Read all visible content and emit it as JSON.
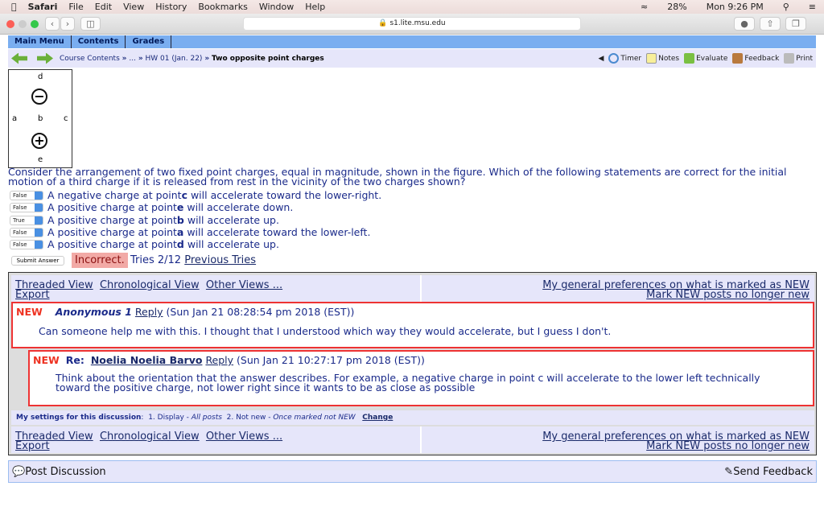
{
  "menubar": {
    "app": "Safari",
    "items": [
      "File",
      "Edit",
      "View",
      "History",
      "Bookmarks",
      "Window",
      "Help"
    ],
    "battery": "28%",
    "clock": "Mon 9:26 PM"
  },
  "browser": {
    "url": "s1.lite.msu.edu"
  },
  "nav_tabs": [
    "Main Menu",
    "Contents",
    "Grades"
  ],
  "breadcrumb": {
    "part1": "Course Contents",
    "sep": "»",
    "part2": "...",
    "part3": "HW 01 (Jan. 22)",
    "current": "Two opposite point charges"
  },
  "tools": {
    "timer": "Timer",
    "notes": "Notes",
    "evaluate": "Evaluate",
    "feedback": "Feedback",
    "print": "Print"
  },
  "figure": {
    "d": "d",
    "a": "a",
    "b": "b",
    "c": "c",
    "e": "e",
    "neg": "−",
    "pos": "+"
  },
  "question": "Consider the arrangement of two fixed point charges, equal in magnitude, shown in the figure. Which of the following statements are correct for the initial motion of a third charge if it is released from rest in the vicinity of the two charges shown?",
  "options": [
    {
      "value": "False",
      "pre": "A negative charge at point ",
      "pt": "c",
      "post": " will accelerate toward the lower-right."
    },
    {
      "value": "False",
      "pre": "A positive charge at point ",
      "pt": "e",
      "post": " will accelerate down."
    },
    {
      "value": "True",
      "pre": "A positive charge at point ",
      "pt": "b",
      "post": " will accelerate up."
    },
    {
      "value": "False",
      "pre": "A positive charge at point ",
      "pt": "a",
      "post": " will accelerate toward the lower-left."
    },
    {
      "value": "False",
      "pre": "A positive charge at point ",
      "pt": "d",
      "post": " will accelerate up."
    }
  ],
  "submit": "Submit Answer",
  "result": "Incorrect.",
  "tries": "Tries 2/12",
  "previous_tries": "Previous Tries",
  "views": {
    "threaded": "Threaded View",
    "chrono": "Chronological View",
    "other": "Other Views ...",
    "export": "Export",
    "prefs": "My general preferences on what is marked as NEW",
    "mark": "Mark NEW posts no longer new"
  },
  "posts": [
    {
      "badge": "NEW",
      "author": "Anonymous 1",
      "reply": "Reply",
      "date": "(Sun Jan 21 08:28:54 pm 2018 (EST))",
      "body": "Can someone help me with this. I thought that I understood which way they would accelerate, but I guess I don't."
    },
    {
      "badge": "NEW",
      "re": "Re:",
      "author": "Noelia Noelia Barvo",
      "reply": "Reply",
      "date": "(Sun Jan 21 10:27:17 pm 2018 (EST))",
      "body": "Think about the orientation that the answer describes. For example, a negative charge in point c will accelerate to the lower left technically toward the positive charge, not lower right since it wants to be as close as possible"
    }
  ],
  "settings": {
    "label": "My settings for this discussion",
    "s1": "1. Display - ",
    "s1v": "All posts",
    "s2": "2. Not new - ",
    "s2v": "Once marked not NEW",
    "change": "Change"
  },
  "post_discussion": "Post Discussion",
  "send_feedback": "Send Feedback"
}
